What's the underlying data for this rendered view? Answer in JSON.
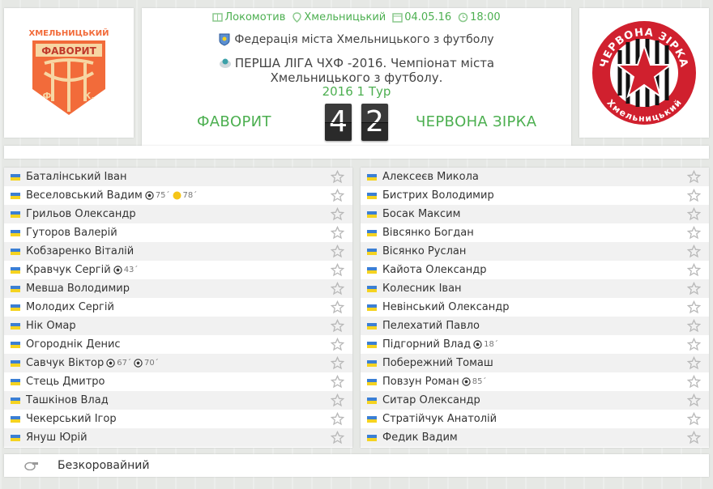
{
  "match": {
    "stadium": "Локомотив",
    "city": "Хмельницький",
    "date": "04.05.16",
    "time": "18:00",
    "federation": "Федерація міста Хмельницького з футболу",
    "league": "ПЕРША ЛІГА ЧХФ -2016. Чемпіонат міста Хмельницького з футболу.",
    "round": "2016 1 Тур",
    "home_team": "ФАВОРИТ",
    "away_team": "ЧЕРВОНА ЗІРКА",
    "home_score": "4",
    "away_score": "2"
  },
  "logos": {
    "home": {
      "top_text": "ХМЕЛЬНИЦЬКИЙ",
      "name_text": "ФАВОРИТ",
      "bottom_left": "Ф.",
      "bottom_right": "К."
    },
    "away": {
      "top_text": "ЧЕРВОНА ЗІРКА",
      "bottom_text": "Хмельницький"
    }
  },
  "home_lineup": [
    {
      "name": "Баталінський Іван",
      "events": []
    },
    {
      "name": "Веселовський Вадим",
      "events": [
        {
          "type": "goal-icon",
          "minute": "75´"
        },
        {
          "type": "yellow-card-icon",
          "minute": "78´"
        }
      ]
    },
    {
      "name": "Грильов Олександр",
      "events": []
    },
    {
      "name": "Гуторов Валерій",
      "events": []
    },
    {
      "name": "Кобзаренко Віталій",
      "events": []
    },
    {
      "name": "Кравчук Сергій",
      "events": [
        {
          "type": "goal-icon",
          "minute": "43´"
        }
      ]
    },
    {
      "name": "Мевша Володимир",
      "events": []
    },
    {
      "name": "Молодих Сергій",
      "events": []
    },
    {
      "name": "Нік Омар",
      "events": []
    },
    {
      "name": "Огороднік Денис",
      "events": []
    },
    {
      "name": "Савчук Віктор",
      "events": [
        {
          "type": "goal-icon",
          "minute": "67´"
        },
        {
          "type": "goal-icon",
          "minute": "70´"
        }
      ]
    },
    {
      "name": "Стець Дмитро",
      "events": []
    },
    {
      "name": "Ташкінов Влад",
      "events": []
    },
    {
      "name": "Чекерський Ігор",
      "events": []
    },
    {
      "name": "Януш Юрій",
      "events": []
    }
  ],
  "away_lineup": [
    {
      "name": "Алексеєв Микола",
      "events": []
    },
    {
      "name": "Бистрих Володимир",
      "events": []
    },
    {
      "name": "Босак Максим",
      "events": []
    },
    {
      "name": "Вівсянко Богдан",
      "events": []
    },
    {
      "name": "Вісянко Руслан",
      "events": []
    },
    {
      "name": "Кайота Олександр",
      "events": []
    },
    {
      "name": "Колесник Іван",
      "events": []
    },
    {
      "name": "Невінський Олександр",
      "events": []
    },
    {
      "name": "Пелехатий Павло",
      "events": []
    },
    {
      "name": "Підгорний Влад",
      "events": [
        {
          "type": "goal-icon",
          "minute": "18´"
        }
      ]
    },
    {
      "name": "Побережний Томаш",
      "events": []
    },
    {
      "name": "Повзун Роман",
      "events": [
        {
          "type": "goal-icon",
          "minute": "85´"
        }
      ]
    },
    {
      "name": "Ситар Олександр",
      "events": []
    },
    {
      "name": "Стратійчук Анатолій",
      "events": []
    },
    {
      "name": "Федик Вадим",
      "events": []
    }
  ],
  "referee": {
    "icon": "whistle-icon",
    "name": "Безкоровайний"
  },
  "colors": {
    "accent": "#4caf50",
    "home_logo": "#f26b3a",
    "away_logo": "#d0202e"
  }
}
